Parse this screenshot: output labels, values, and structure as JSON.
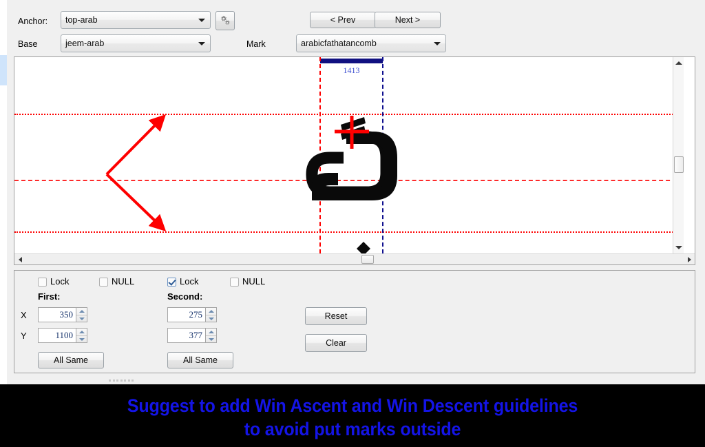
{
  "toolbar": {
    "anchor_label": "Anchor:",
    "anchor_value": "top-arab",
    "base_label": "Base",
    "base_value": "jeem-arab",
    "mark_label": "Mark",
    "mark_value": "arabicfathatancomb",
    "settings_icon": "gear-icon",
    "prev_label": "< Prev",
    "next_label": "Next >"
  },
  "canvas": {
    "advance_width": "1413",
    "guide_color_red": "#fe0000",
    "guide_color_blue": "#10108f",
    "advance_bar_color": "#101080",
    "glyph_base": "jeem-arab",
    "glyph_mark": "arabicfathatancomb"
  },
  "properties": {
    "first_lock_label": "Lock",
    "first_null_label": "NULL",
    "first_lock_checked": false,
    "first_null_checked": false,
    "second_lock_label": "Lock",
    "second_null_label": "NULL",
    "second_lock_checked": true,
    "second_null_checked": false,
    "first_group_label": "First:",
    "second_group_label": "Second:",
    "x_label": "X",
    "y_label": "Y",
    "first_x": "350",
    "first_y": "1100",
    "second_x": "275",
    "second_y": "377",
    "first_all_same_label": "All Same",
    "second_all_same_label": "All Same",
    "reset_label": "Reset",
    "clear_label": "Clear"
  },
  "caption": {
    "line1": "Suggest to add Win Ascent and Win Descent guidelines",
    "line2": "to avoid put marks outside",
    "color": "#1414e6"
  }
}
